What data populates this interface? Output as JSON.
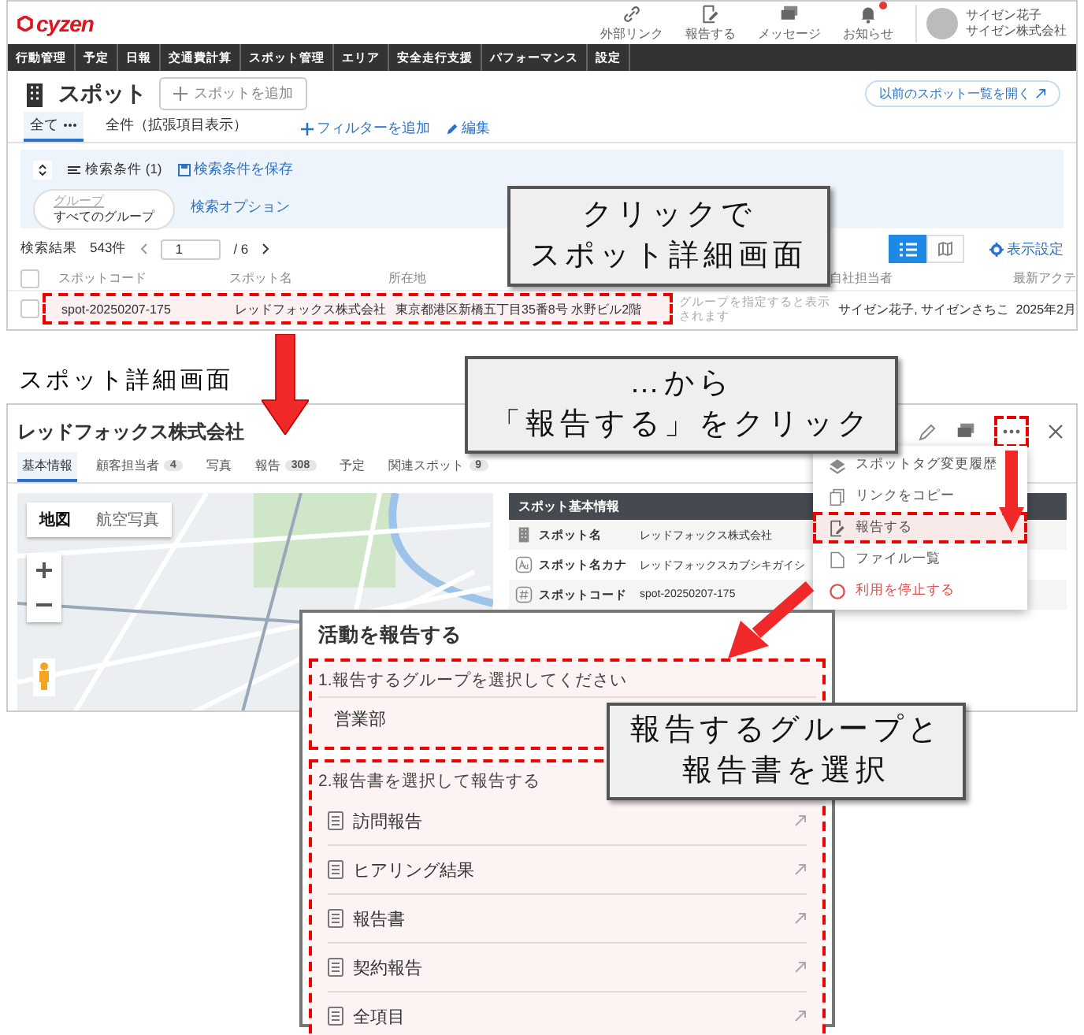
{
  "list_screen": {
    "logo": "cyzen",
    "header_actions": [
      {
        "kind": "link",
        "label": "外部リンク",
        "notification": false
      },
      {
        "kind": "report",
        "label": "報告する",
        "notification": false
      },
      {
        "kind": "message",
        "label": "メッセージ",
        "notification": false
      },
      {
        "kind": "bell",
        "label": "お知らせ",
        "notification": true
      }
    ],
    "user": {
      "name": "サイゼン花子",
      "company": "サイゼン株式会社"
    },
    "nav": [
      "行動管理",
      "予定",
      "日報",
      "交通費計算",
      "スポット管理",
      "エリア",
      "安全走行支援",
      "パフォーマンス",
      "設定"
    ],
    "page_title": "スポット",
    "add_button": "スポットを追加",
    "old_list_link": "以前のスポット一覧を開く",
    "views": [
      {
        "label": "全て",
        "selected": true
      },
      {
        "label": "全件（拡張項目表示）",
        "selected": false
      }
    ],
    "filter_add": "フィルターを追加",
    "edit": "編集",
    "search_conditions": "検索条件 (1)",
    "save_conditions": "検索条件を保存",
    "group_filter": {
      "label": "グループ",
      "value": "すべてのグループ"
    },
    "search_options": "検索オプション",
    "results": {
      "label": "検索結果",
      "count": "543件",
      "page": "1",
      "pages": "/ 6"
    },
    "view_modes": [
      {
        "kind": "list",
        "selected": true
      },
      {
        "kind": "map",
        "selected": false
      }
    ],
    "display_settings": "表示設定",
    "table": {
      "all_checked": false,
      "columns": [
        {
          "label": "スポットコード"
        },
        {
          "label": "スポット名"
        },
        {
          "label": "所在地"
        },
        {},
        {
          "label": "自社担当者"
        },
        {
          "label": "最新アクテ"
        }
      ],
      "rows": [
        {
          "checked": false,
          "highlighted": true,
          "cells": [
            "spot-20250207-175",
            "レッドフォックス株式会社",
            "東京都港区新橋五丁目35番8号 水野ビル2階",
            "グループを指定すると表示されます",
            "サイゼン花子, サイゼンさちこ",
            "2025年2月"
          ]
        }
      ]
    }
  },
  "detail_label": "スポット詳細画面",
  "detail_screen": {
    "title": "レッドフォックス株式会社",
    "more_highlighted": true,
    "tabs": [
      {
        "label": "基本情報",
        "selected": true
      },
      {
        "label": "顧客担当者",
        "count": "4",
        "selected": false
      },
      {
        "label": "写真",
        "selected": false
      },
      {
        "label": "報告",
        "count": "308",
        "selected": false
      },
      {
        "label": "予定",
        "selected": false
      },
      {
        "label": "関連スポット",
        "count": "9",
        "selected": false
      }
    ],
    "map_types": [
      {
        "label": "地図",
        "selected": true
      },
      {
        "label": "航空写真",
        "selected": false
      }
    ],
    "info": {
      "heading": "スポット基本情報",
      "rows": [
        {
          "kind": "name",
          "label": "スポット名",
          "value": "レッドフォックス株式会社"
        },
        {
          "kind": "kana",
          "label": "スポット名カナ",
          "value": "レッドフォックスカブシキガイシ"
        },
        {
          "kind": "code",
          "label": "スポットコード",
          "value": "spot-20250207-175"
        }
      ]
    },
    "menu": [
      {
        "kind": "tag",
        "label": "スポットタグ変更履歴",
        "highlighted": false
      },
      {
        "kind": "copy",
        "label": "リンクをコピー",
        "highlighted": false
      },
      {
        "kind": "report",
        "label": "報告する",
        "highlighted": true
      },
      {
        "kind": "file",
        "label": "ファイル一覧",
        "highlighted": false
      },
      {
        "kind": "danger",
        "label": "利用を停止する",
        "highlighted": false
      }
    ]
  },
  "report_modal": {
    "title": "活動を報告する",
    "group_step": {
      "label": "1.報告するグループを選択してください",
      "value": "営業部",
      "highlighted": true
    },
    "report_step": {
      "label": "2.報告書を選択して報告する",
      "highlighted": true,
      "reports": [
        "訪問報告",
        "ヒアリング結果",
        "報告書",
        "契約報告",
        "全項目"
      ]
    }
  },
  "callouts": [
    {
      "lines": [
        "クリックで",
        "スポット詳細画面"
      ]
    },
    {
      "lines": [
        "…から",
        "「報告する」をクリック"
      ]
    },
    {
      "lines": [
        "報告するグループと",
        "報告書を選択"
      ]
    }
  ]
}
